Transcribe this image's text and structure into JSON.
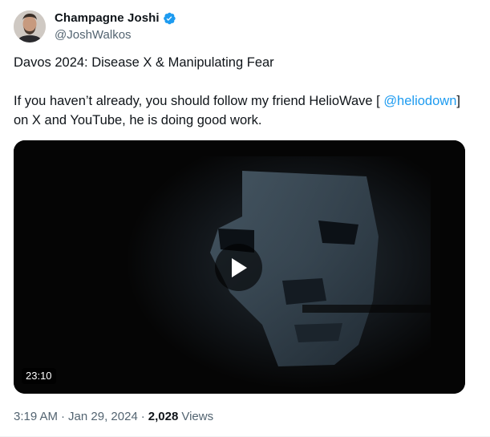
{
  "author": {
    "display_name": "Champagne Joshi",
    "handle": "@JoshWalkos",
    "verified": true,
    "verified_color": "#1d9bf0",
    "avatar_icon": "avatar-photo"
  },
  "tweet": {
    "line1": "Davos 2024: Disease X & Manipulating Fear",
    "line2_before": "If you haven’t already, you should follow my friend HelioWave [ ",
    "mention": "@heliodown",
    "line2_after": "] on X and YouTube, he is doing good work.",
    "mention_color": "#1d9bf0"
  },
  "media": {
    "type": "video",
    "duration": "23:10",
    "play_icon": "play-icon"
  },
  "meta": {
    "time": "3:19 AM",
    "date": "Jan 29, 2024",
    "separator": "·",
    "views_count": "2,028",
    "views_label": "Views"
  }
}
